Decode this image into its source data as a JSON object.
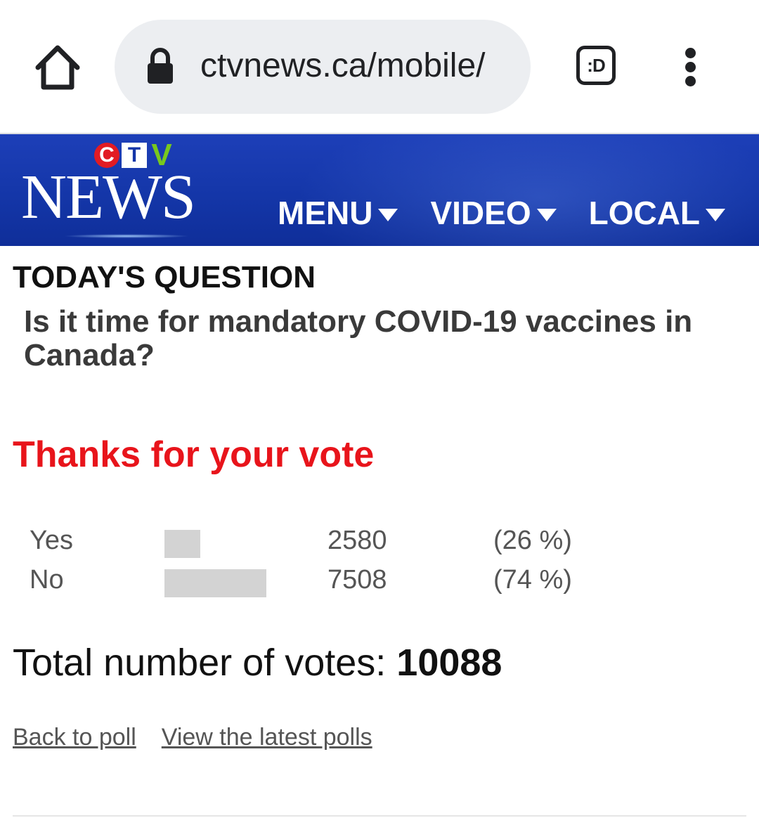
{
  "browser": {
    "url": "ctvnews.ca/mobile/",
    "tab_label": ":D"
  },
  "logo": {
    "ctv_c": "C",
    "ctv_t": "T",
    "ctv_v": "V",
    "news": "NEWS"
  },
  "nav": {
    "items": [
      {
        "label": "MENU"
      },
      {
        "label": "VIDEO"
      },
      {
        "label": "LOCAL"
      }
    ]
  },
  "poll": {
    "heading": "TODAY'S QUESTION",
    "question": "Is it time for mandatory COVID-19 vaccines in Canada?",
    "thanks": "Thanks for your vote",
    "results": [
      {
        "label": "Yes",
        "count": "2580",
        "percent": "(26 %)",
        "share": 0.26
      },
      {
        "label": "No",
        "count": "7508",
        "percent": "(74 %)",
        "share": 0.74
      }
    ],
    "total_label": "Total number of votes: ",
    "total_value": "10088",
    "links": {
      "back": "Back to poll",
      "latest": "View the latest polls"
    }
  },
  "colors": {
    "header_blue": "#1436a8",
    "thanks_red": "#e8141b",
    "bar_gray": "#d3d3d3"
  },
  "icons": {
    "home": "home-icon",
    "lock": "lock-icon",
    "more": "more-vert-icon",
    "caret": "caret-down-icon"
  }
}
